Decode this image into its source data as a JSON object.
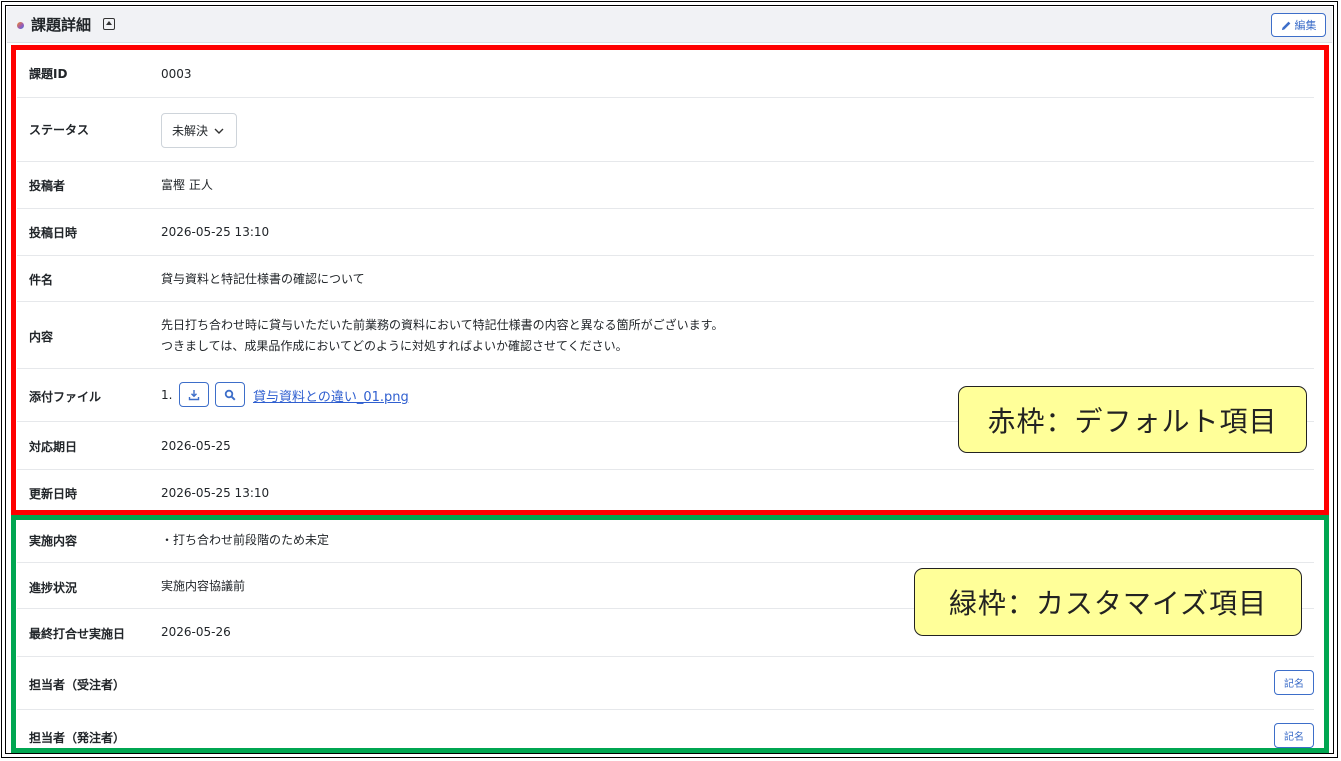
{
  "panel": {
    "title": "課題詳細",
    "edit_label": "編集"
  },
  "default_fields": {
    "issue_id": {
      "label": "課題ID",
      "value": "0003"
    },
    "status": {
      "label": "ステータス",
      "value": "未解決"
    },
    "poster": {
      "label": "投稿者",
      "value": "富樫 正人"
    },
    "posted_at": {
      "label": "投稿日時",
      "value": "2026-05-25 13:10"
    },
    "subject": {
      "label": "件名",
      "value": "貸与資料と特記仕様書の確認について"
    },
    "content": {
      "label": "内容",
      "line1": "先日打ち合わせ時に貸与いただいた前業務の資料において特記仕様書の内容と異なる箇所がございます。",
      "line2": "つきましては、成果品作成においてどのように対処すればよいか確認させてください。"
    },
    "attachment": {
      "label": "添付ファイル",
      "index": "1.",
      "file_name": "貸与資料との違い_01.png"
    },
    "due_date": {
      "label": "対応期日",
      "value": "2026-05-25"
    },
    "updated_at": {
      "label": "更新日時",
      "value": "2026-05-25 13:10"
    }
  },
  "custom_fields": {
    "implementation": {
      "label": "実施内容",
      "value": "・打ち合わせ前段階のため未定"
    },
    "progress": {
      "label": "進捗状況",
      "value": "実施内容協議前"
    },
    "last_meeting": {
      "label": "最終打合せ実施日",
      "value": "2026-05-26"
    },
    "contractor_rep": {
      "label": "担当者（受注者）",
      "button": "記名"
    },
    "client_rep": {
      "label": "担当者（発注者）",
      "button": "記名"
    }
  },
  "annotations": {
    "red_callout": "赤枠：デフォルト項目",
    "green_callout": "緑枠：カスタマイズ項目"
  },
  "colors": {
    "default_frame": "#ff0000",
    "custom_frame": "#00a651",
    "callout_bg": "#ffff99",
    "accent": "#3d6ec9"
  },
  "icons": {
    "collapse": "collapse-up-icon",
    "edit": "pencil-icon",
    "status_dropdown": "chevron-down-icon",
    "download": "download-icon",
    "preview": "magnifier-icon"
  }
}
